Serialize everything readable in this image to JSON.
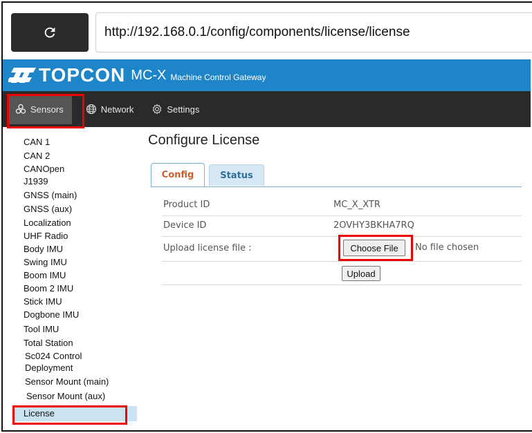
{
  "browser": {
    "url": "http://192.168.0.1/config/components/license/license"
  },
  "brand": {
    "logo": "TOPCON",
    "product": "MC-X",
    "subtitle": "Machine Control Gateway",
    "color": "#1d85c8"
  },
  "nav": {
    "items": [
      {
        "label": "Sensors",
        "icon": "sensors-icon",
        "active": true
      },
      {
        "label": "Network",
        "icon": "globe-icon"
      },
      {
        "label": "Settings",
        "icon": "gear-icon"
      }
    ]
  },
  "sidebar": {
    "items": [
      "CAN 1",
      "CAN 2",
      "CANOpen",
      "J1939",
      "GNSS (main)",
      "GNSS (aux)",
      "Localization",
      "UHF Radio",
      "Body IMU",
      "Swing IMU",
      "Boom IMU",
      "Boom 2 IMU",
      "Stick IMU",
      "Dogbone IMU",
      "Tool IMU",
      "Total Station",
      "Sc024 Control",
      "Deployment",
      "Sensor Mount (main)",
      "Sensor Mount (aux)",
      "License"
    ],
    "active": "License"
  },
  "main": {
    "title": "Configure License",
    "tabs": [
      {
        "label": "Config",
        "active": true
      },
      {
        "label": "Status"
      }
    ],
    "rows": [
      {
        "label": "Product ID",
        "value": "MC_X_XTR"
      },
      {
        "label": "Device ID",
        "value": "2OVHY3BKHA7RQ"
      },
      {
        "label": "Upload license file :"
      }
    ],
    "choose_file_label": "Choose File",
    "no_file_text": "No file chosen",
    "upload_label": "Upload"
  },
  "highlight_color": "#e00000"
}
